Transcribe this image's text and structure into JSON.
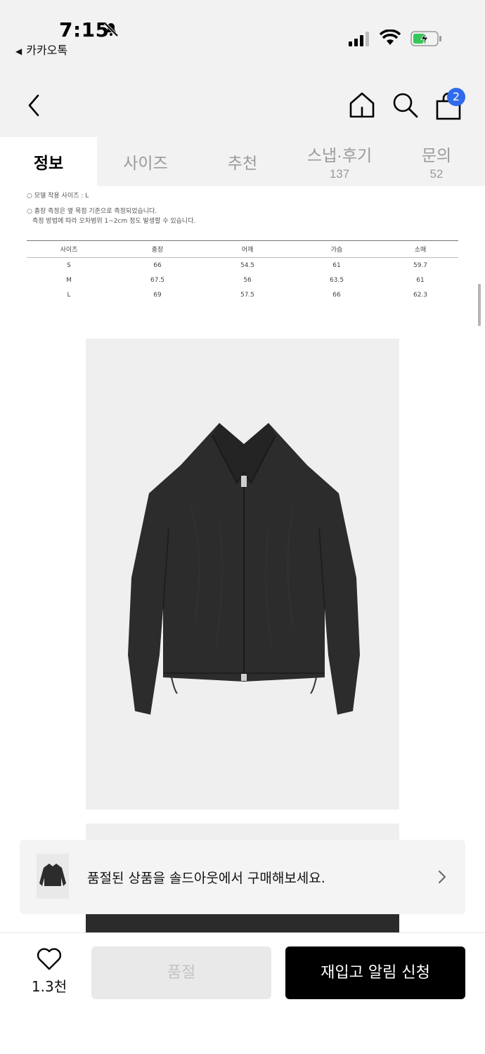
{
  "status_bar": {
    "time": "7:15",
    "back_app": "카카오톡",
    "back_arrow": "◀"
  },
  "header": {
    "cart_count": "2",
    "icons": [
      "back-icon",
      "home-icon",
      "search-icon",
      "shopping-bag-icon"
    ]
  },
  "tabs": [
    {
      "label": "정보",
      "count": ""
    },
    {
      "label": "사이즈",
      "count": ""
    },
    {
      "label": "추천",
      "count": ""
    },
    {
      "label": "스냅·후기",
      "count": "137"
    },
    {
      "label": "문의",
      "count": "52"
    }
  ],
  "size_info": {
    "model_note": "○ 모델 착용 사이즈 : L",
    "measure_note_1": "○ 총장 측정은 옆 목점 기준으로 측정되었습니다.",
    "measure_note_2": "측정 방법에 따라 오차범위 1~2cm 정도 발생할 수 있습니다.",
    "headers": [
      "사이즈",
      "총장",
      "어깨",
      "가슴",
      "소매"
    ],
    "rows": [
      [
        "S",
        "66",
        "54.5",
        "61",
        "59.7"
      ],
      [
        "M",
        "67.5",
        "56",
        "63.5",
        "61"
      ],
      [
        "L",
        "69",
        "57.5",
        "66",
        "62.3"
      ]
    ]
  },
  "soldout_banner": {
    "text": "품절된 상품을 솔드아웃에서 구매해보세요."
  },
  "bottom_bar": {
    "like_count": "1.3천",
    "soldout_label": "품절",
    "restock_label": "재입고 알림 신청"
  },
  "colors": {
    "accent_badge": "#2f6bea",
    "header_bg": "#f2f2f2",
    "primary_button": "#000000",
    "disabled_button": "#e9e9e9"
  }
}
